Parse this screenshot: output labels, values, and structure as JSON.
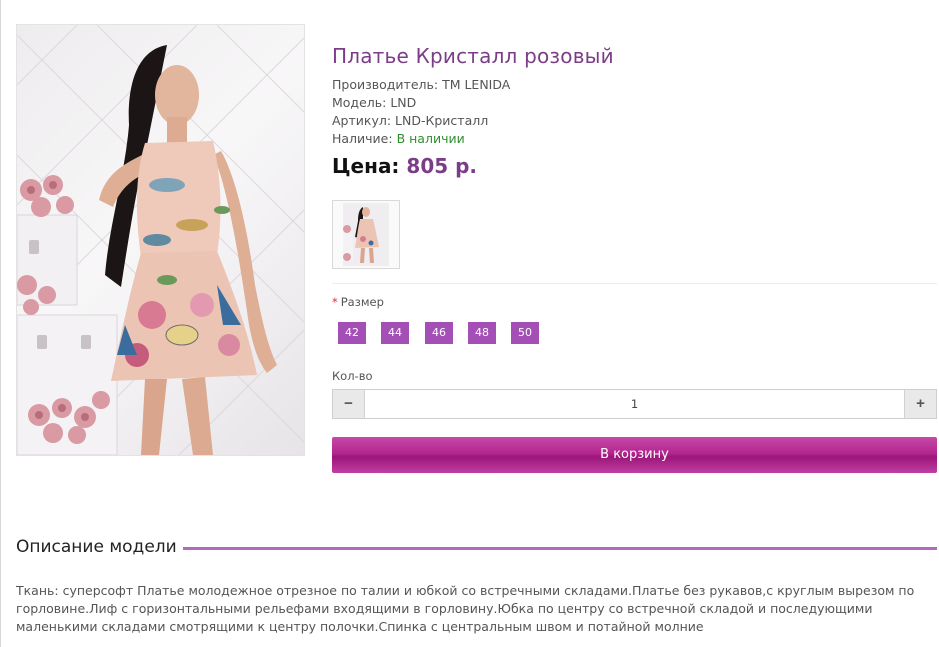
{
  "product": {
    "title": "Платье Кристалл розовый",
    "manufacturer_label": "Производитель:",
    "manufacturer": "ТМ LENIDA",
    "model_label": "Модель:",
    "model": "LND",
    "sku_label": "Артикул:",
    "sku": "LND-Кристалл",
    "availability_label": "Наличие:",
    "availability": "В наличии",
    "price_label": "Цена:",
    "price": "805 р."
  },
  "options": {
    "size_required_mark": "*",
    "size_label": "Размер",
    "sizes": [
      "42",
      "44",
      "46",
      "48",
      "50"
    ],
    "qty_label": "Кол-во",
    "qty_value": "1",
    "minus": "−",
    "plus": "+",
    "add_to_cart": "В корзину"
  },
  "description": {
    "heading": "Описание модели",
    "text": "Ткань: суперсофт Платье молодежное отрезное по талии и юбкой со встречными складами.Платье без рукавов,с круглым вырезом по горловине.Лиф с горизонтальными рельефами входящими в горловину.Юбка по центру со встречной складой и последующими маленькими складами смотрящими к центру полочки.Спинка с центральным швом и потайной молние"
  },
  "colors": {
    "accent": "#7b3d87",
    "size_button": "#a34fb5",
    "cart_button": "#b3278f",
    "in_stock": "#2f8f2f"
  }
}
